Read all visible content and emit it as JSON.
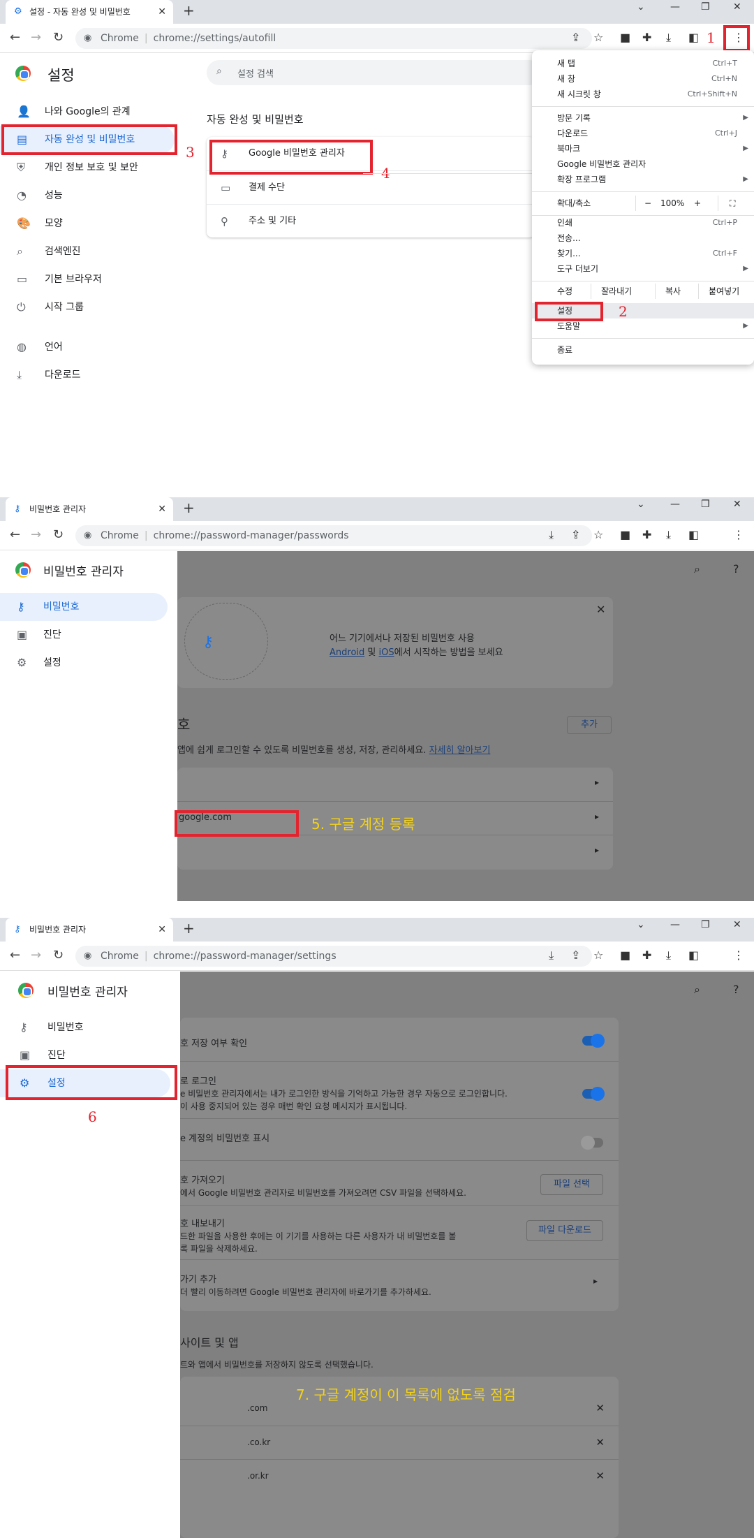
{
  "frame1": {
    "tab_title": "설정 - 자동 완성 및 비밀번호",
    "omni_chrome": "Chrome",
    "omni_url": "chrome://settings/autofill",
    "settings_title": "설정",
    "search_placeholder": "설정 검색",
    "sidebar": [
      {
        "label": "나와 Google의 관계",
        "icon": "person-icon"
      },
      {
        "label": "자동 완성 및 비밀번호",
        "icon": "clipboard-icon"
      },
      {
        "label": "개인 정보 보호 및 보안",
        "icon": "shield-icon"
      },
      {
        "label": "성능",
        "icon": "gauge-icon"
      },
      {
        "label": "모양",
        "icon": "palette-icon"
      },
      {
        "label": "검색엔진",
        "icon": "search-icon"
      },
      {
        "label": "기본 브라우저",
        "icon": "browser-icon"
      },
      {
        "label": "시작 그룹",
        "icon": "power-icon"
      },
      {
        "label": "언어",
        "icon": "globe-icon"
      },
      {
        "label": "다운로드",
        "icon": "download-icon"
      }
    ],
    "section_title": "자동 완성 및 비밀번호",
    "autofill_rows": [
      {
        "label": "Google 비밀번호 관리자",
        "icon": "key-icon"
      },
      {
        "label": "결제 수단",
        "icon": "card-icon"
      },
      {
        "label": "주소 및 기타",
        "icon": "location-icon"
      }
    ],
    "menu": {
      "items": [
        {
          "label": "새 탭",
          "shortcut": "Ctrl+T"
        },
        {
          "label": "새 창",
          "shortcut": "Ctrl+N"
        },
        {
          "label": "새 시크릿 창",
          "shortcut": "Ctrl+Shift+N"
        },
        {
          "label": "방문 기록",
          "shortcut": ""
        },
        {
          "label": "다운로드",
          "shortcut": "Ctrl+J"
        },
        {
          "label": "북마크",
          "shortcut": ""
        },
        {
          "label": "Google 비밀번호 관리자",
          "shortcut": ""
        },
        {
          "label": "확장 프로그램",
          "shortcut": ""
        },
        {
          "label": "인쇄",
          "shortcut": "Ctrl+P"
        },
        {
          "label": "전송...",
          "shortcut": ""
        },
        {
          "label": "찾기...",
          "shortcut": "Ctrl+F"
        },
        {
          "label": "도구 더보기",
          "shortcut": ""
        },
        {
          "label": "설정",
          "shortcut": ""
        },
        {
          "label": "도움말",
          "shortcut": ""
        },
        {
          "label": "종료",
          "shortcut": ""
        }
      ],
      "zoom_label": "확대/축소",
      "zoom_minus": "−",
      "zoom_value": "100%",
      "zoom_plus": "+",
      "edit_label": "수정",
      "cut": "잘라내기",
      "copy": "복사",
      "paste": "붙여넣기"
    },
    "annotations": [
      "1",
      "2",
      "3",
      "4"
    ]
  },
  "frame2": {
    "tab_title": "비밀번호 관리자",
    "omni_chrome": "Chrome",
    "omni_url": "chrome://password-manager/passwords",
    "pm_title": "비밀번호 관리자",
    "sidebar": [
      {
        "label": "비밀번호",
        "icon": "key-icon"
      },
      {
        "label": "진단",
        "icon": "checkup-icon"
      },
      {
        "label": "설정",
        "icon": "gear-icon"
      }
    ],
    "promo_line1": "어느 기기에서나 저장된 비밀번호 사용",
    "promo_android": "Android",
    "promo_and": "및",
    "promo_ios": "iOS",
    "promo_rest": "에서 시작하는 방법을 보세요",
    "section_frag": "호",
    "add_button": "추가",
    "desc": "앱에 쉽게 로그인할 수 있도록 비밀번호를 생성, 저장, 관리하세요.",
    "learn_more": "자세히 알아보기",
    "site_frag": "google.com",
    "annotation": "5. 구글 계정 등록"
  },
  "frame3": {
    "tab_title": "비밀번호 관리자",
    "omni_chrome": "Chrome",
    "omni_url": "chrome://password-manager/settings",
    "pm_title": "비밀번호 관리자",
    "sidebar": [
      {
        "label": "비밀번호",
        "icon": "key-icon"
      },
      {
        "label": "진단",
        "icon": "checkup-icon"
      },
      {
        "label": "설정",
        "icon": "gear-icon"
      }
    ],
    "settings": [
      {
        "title": "호 저장 여부 확인",
        "desc": "",
        "control": "toggle-on"
      },
      {
        "title": "로 로그인",
        "desc": "e 비밀번호 관리자에서는 내가 로그인한 방식을 기억하고 가능한 경우 자동으로 로그인합니다.",
        "desc2": "이 사용 중지되어 있는 경우 매번 확인 요청 메시지가 표시됩니다.",
        "control": "toggle-on"
      },
      {
        "title": "e 계정의 비밀번호 표시",
        "desc": "",
        "control": "toggle-off"
      },
      {
        "title": "호 가져오기",
        "desc": "에서 Google 비밀번호 관리자로 비밀번호를 가져오려면 CSV 파일을 선택하세요.",
        "control": "파일 선택"
      },
      {
        "title": "호 내보내기",
        "desc": "드한 파일을 사용한 후에는 이 기기를 사용하는 다른 사용자가 내 비밀번호를 볼",
        "desc2": "록 파일을 삭제하세요.",
        "control": "파일 다운로드"
      },
      {
        "title": "가기 추가",
        "desc": "더 빨리 이동하려면 Google 비밀번호 관리자에 바로가기를 추가하세요.",
        "control": "arrow"
      }
    ],
    "blocked_title": "사이트 및 앱",
    "blocked_desc": "트와 앱에서 비밀번호를 저장하지 않도록 선택했습니다.",
    "blocked_sites": [
      ".com",
      ".co.kr",
      ".or.kr"
    ],
    "annotation6": "6",
    "annotation7": "7. 구글 계정이 이 목록에 없도록 점검"
  }
}
